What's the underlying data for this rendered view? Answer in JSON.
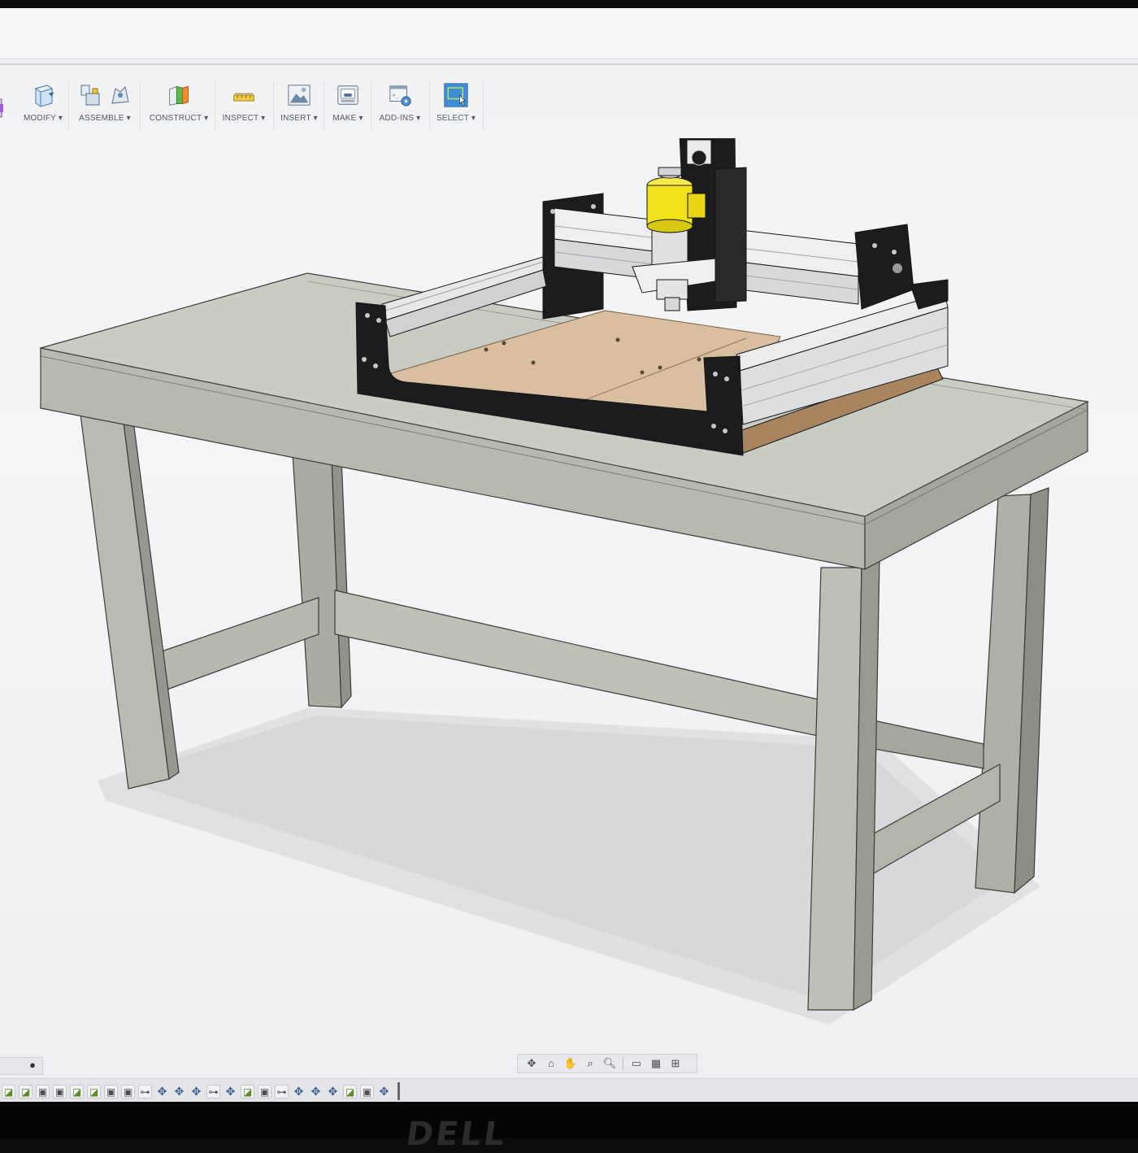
{
  "toolbar": {
    "groups": [
      {
        "label": "MODIFY ▾",
        "icon": "modify-icon"
      },
      {
        "label": "ASSEMBLE ▾",
        "icon": "assemble-icon"
      },
      {
        "label": "CONSTRUCT ▾",
        "icon": "construct-icon"
      },
      {
        "label": "INSPECT ▾",
        "icon": "inspect-icon"
      },
      {
        "label": "INSERT ▾",
        "icon": "insert-icon"
      },
      {
        "label": "MAKE ▾",
        "icon": "make-icon"
      },
      {
        "label": "ADD-INS ▾",
        "icon": "add-ins-icon"
      },
      {
        "label": "SELECT ▾",
        "icon": "select-icon"
      }
    ]
  },
  "colors": {
    "select_active": "#3f8fd6",
    "table_gray": "#b8bbb2",
    "spindle_yellow": "#f2e21a",
    "spoilboard": "#d9bf9f",
    "frame_black": "#1c1c1e"
  },
  "navigation_bar": {
    "icons": [
      "orbit-icon",
      "look-at-icon",
      "pan-hand-icon",
      "zoom-window-icon",
      "zoom-icon",
      "display-settings-icon",
      "grid-icon",
      "viewports-icon"
    ]
  },
  "browser_panel": {
    "icon": "expand-dot-icon"
  },
  "timeline": {
    "items": [
      "sketch",
      "sketch",
      "extrude",
      "extrude",
      "sketch",
      "sketch",
      "extrude",
      "extrude",
      "joint",
      "move",
      "move",
      "move",
      "joint",
      "move",
      "sketch",
      "extrude",
      "joint",
      "move",
      "move",
      "move",
      "sketch",
      "extrude",
      "move",
      "marker"
    ]
  },
  "bezel": {
    "logo": "DELL"
  }
}
